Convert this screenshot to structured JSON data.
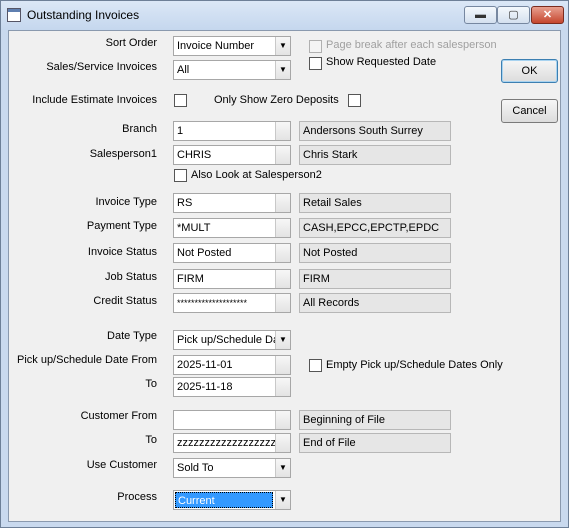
{
  "window": {
    "title": "Outstanding Invoices"
  },
  "caption_buttons": {
    "minimize": "▬",
    "maximize": "▢",
    "close": "✕"
  },
  "labels": {
    "sort_order": "Sort Order",
    "sales_service": "Sales/Service Invoices",
    "include_estimate": "Include Estimate Invoices",
    "only_zero_deposits": "Only Show Zero Deposits",
    "page_break": "Page break after each salesperson",
    "show_requested_date": "Show Requested Date",
    "branch": "Branch",
    "salesperson1": "Salesperson1",
    "also_look": "Also Look at Salesperson2",
    "invoice_type": "Invoice Type",
    "payment_type": "Payment Type",
    "invoice_status": "Invoice Status",
    "job_status": "Job Status",
    "credit_status": "Credit Status",
    "date_type": "Date Type",
    "pickup_from": "Pick up/Schedule Date From",
    "pickup_to": "To",
    "empty_pickup": "Empty Pick up/Schedule Dates Only",
    "customer_from": "Customer From",
    "customer_to": "To",
    "use_customer": "Use Customer",
    "process": "Process"
  },
  "values": {
    "sort_order": "Invoice Number",
    "sales_service": "All",
    "branch": "1",
    "branch_desc": "Andersons South Surrey",
    "salesperson1": "CHRIS",
    "salesperson1_desc": "Chris Stark",
    "invoice_type": "RS",
    "invoice_type_desc": "Retail Sales",
    "payment_type": "*MULT",
    "payment_type_desc": "CASH,EPCC,EPCTP,EPDC",
    "invoice_status": "Not Posted",
    "invoice_status_desc": "Not Posted",
    "job_status": "FIRM",
    "job_status_desc": "FIRM",
    "credit_status": "********************",
    "credit_status_desc": "All Records",
    "date_type": "Pick up/Schedule Da",
    "pickup_from": "2025-11-01",
    "pickup_to": "2025-11-18",
    "customer_from": "",
    "customer_from_desc": "Beginning of File",
    "customer_to": "zzzzzzzzzzzzzzzzzz",
    "customer_to_desc": "End of File",
    "use_customer": "Sold To",
    "process": "Current"
  },
  "buttons": {
    "ok": "OK",
    "cancel": "Cancel"
  },
  "icons": {
    "dropdown": "▼"
  }
}
